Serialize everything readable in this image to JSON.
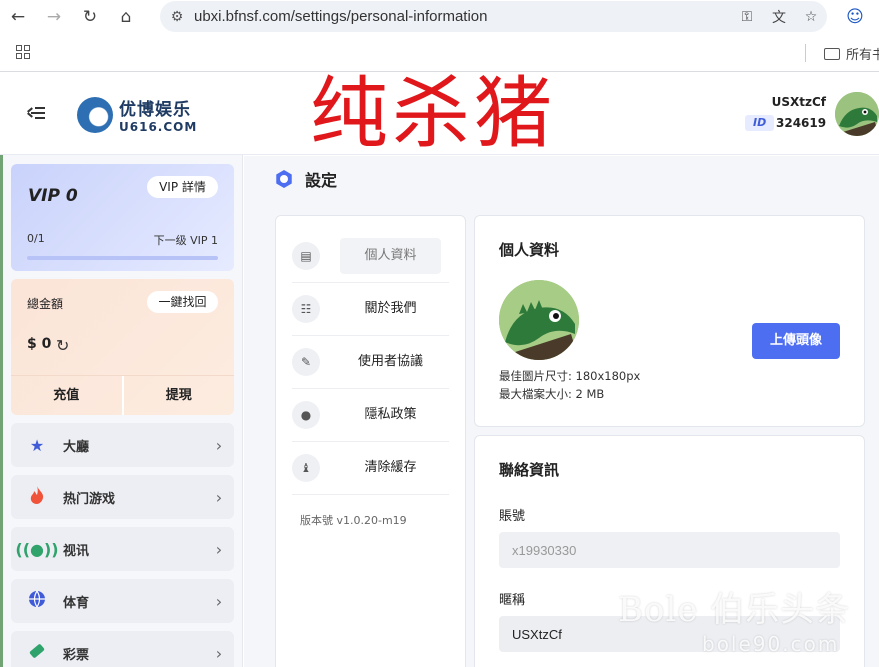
{
  "browser": {
    "url": "ubxi.bfnsf.com/settings/personal-information",
    "bookmarks_folder": "所有书"
  },
  "header": {
    "logo_top": "优博娱乐",
    "logo_bottom": "U616.COM",
    "watermark": "纯杀猪",
    "username": "USXtzCf",
    "id_label": "ID",
    "user_id": "324619"
  },
  "sidebar": {
    "vip": {
      "title": "VIP 0",
      "detail_button": "VIP 詳情",
      "progress_text": "0/1",
      "next_level": "下一级 VIP 1",
      "progress": 0
    },
    "balance": {
      "label": "總金額",
      "recover_button": "一鍵找回",
      "value": "$ 0",
      "deposit": "充值",
      "withdraw": "提現"
    },
    "items": [
      {
        "label": "大廳",
        "icon": "star-icon",
        "color": "#3f5bd8"
      },
      {
        "label": "热门游戏",
        "icon": "fire-icon",
        "color": "#f0533a"
      },
      {
        "label": "视讯",
        "icon": "broadcast-icon",
        "color": "#2fa36b"
      },
      {
        "label": "体育",
        "icon": "ball-icon",
        "color": "#3f5bd8"
      },
      {
        "label": "彩票",
        "icon": "ticket-icon",
        "color": "#2fa36b"
      }
    ]
  },
  "main": {
    "page_title": "設定",
    "menu": [
      {
        "label": "個人資料",
        "icon": "id-card-icon",
        "active": true
      },
      {
        "label": "關於我們",
        "icon": "document-icon",
        "active": false
      },
      {
        "label": "使用者協議",
        "icon": "agreement-icon",
        "active": false
      },
      {
        "label": "隱私政策",
        "icon": "lock-icon",
        "active": false
      },
      {
        "label": "清除緩存",
        "icon": "broom-icon",
        "active": false
      }
    ],
    "version": "版本號 v1.0.20-m19",
    "profile_card": {
      "title": "個人資料",
      "size_note": "最佳圖片尺寸: 180x180px",
      "file_note": "最大檔案大小: 2 MB",
      "upload_button": "上傳頭像"
    },
    "contact_card": {
      "title": "聯絡資訊",
      "account_label": "賬號",
      "account_value": "x19930330",
      "nickname_label": "暱稱",
      "nickname_value": "USXtzCf"
    }
  },
  "overlay_watermark": {
    "big": "Bole 伯乐头条",
    "small": "bole90.com"
  },
  "colors": {
    "accent": "#4e6ef2",
    "watermark_red": "#e0181c"
  }
}
